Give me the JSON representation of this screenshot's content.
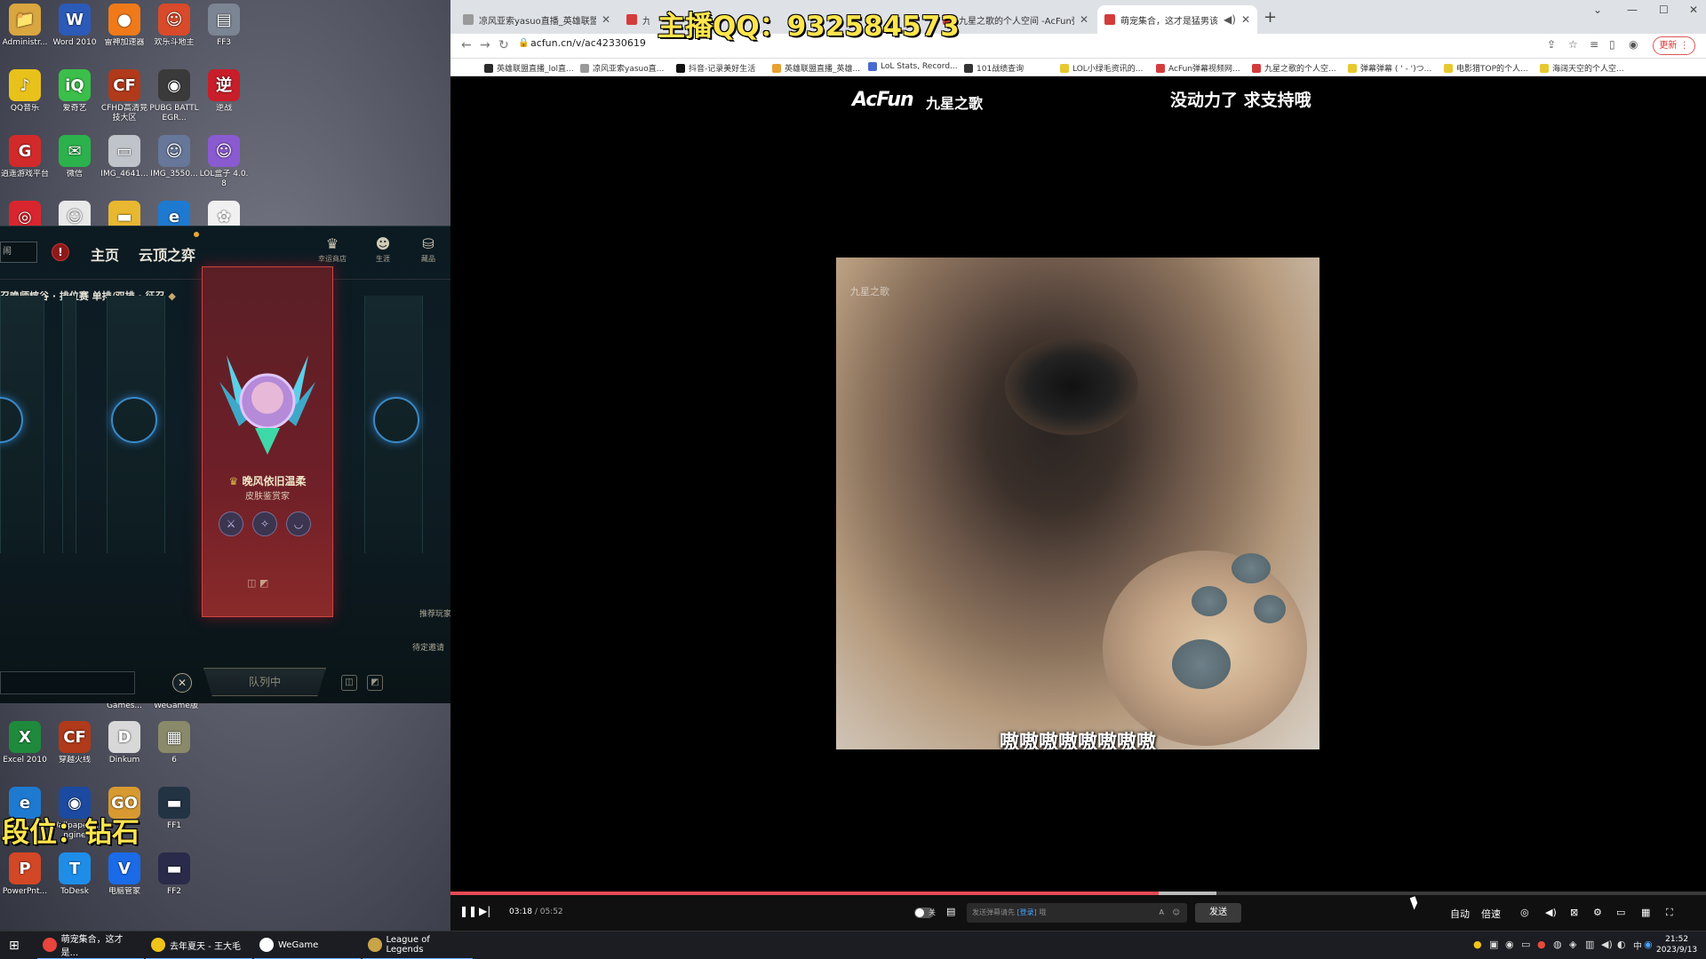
{
  "overlay": {
    "qq": "主播QQ：932584573",
    "rank": "段位：钻石"
  },
  "desktop": {
    "icons_top": [
      {
        "label": "Administr...",
        "glyph": "📁",
        "color": "#d9a640"
      },
      {
        "label": "Word 2010",
        "glyph": "W",
        "color": "#2b5ab8"
      },
      {
        "label": "雷神加速器",
        "glyph": "●",
        "color": "#f07a1a"
      },
      {
        "label": "欢乐斗地主",
        "glyph": "☺",
        "color": "#d94a2a"
      },
      {
        "label": "FF3",
        "glyph": "▤",
        "color": "#7b8593"
      },
      {
        "label": "QQ音乐",
        "glyph": "♪",
        "color": "#e8c21a"
      },
      {
        "label": "爱奇艺",
        "glyph": "iQ",
        "color": "#3bbf4a"
      },
      {
        "label": "CFHD高清竞技大区",
        "glyph": "CF",
        "color": "#b03a1a"
      },
      {
        "label": "PUBG BATTLEGR...",
        "glyph": "◉",
        "color": "#3a3a3a"
      },
      {
        "label": "逆战",
        "glyph": "逆",
        "color": "#c81e2a"
      },
      {
        "label": "逍遥游戏平台",
        "glyph": "G",
        "color": "#d22a2a"
      },
      {
        "label": "微信",
        "glyph": "✉",
        "color": "#2bb24c"
      },
      {
        "label": "IMG_4641...",
        "glyph": "▭",
        "color": "#bfc4ca"
      },
      {
        "label": "IMG_3550...",
        "glyph": "☺",
        "color": "#667799"
      },
      {
        "label": "LOL盒子 4.0.8",
        "glyph": "☺",
        "color": "#8a5ad0"
      },
      {
        "label": "",
        "glyph": "◎",
        "color": "#d9262e"
      },
      {
        "label": "",
        "glyph": "☺",
        "color": "#e8e8e8"
      },
      {
        "label": "",
        "glyph": "▬",
        "color": "#e8b830"
      },
      {
        "label": "",
        "glyph": "e",
        "color": "#1e7ad0"
      },
      {
        "label": "",
        "glyph": "✿",
        "color": "#f0f0f0"
      }
    ],
    "icons_bottom": [
      {
        "label": "Games...",
        "glyph": "",
        "color": "transparent"
      },
      {
        "label": "WeGame版",
        "glyph": "",
        "color": "transparent"
      },
      {
        "label": "Excel 2010",
        "glyph": "X",
        "color": "#1f8a3c"
      },
      {
        "label": "穿越火线",
        "glyph": "CF",
        "color": "#b03a1a"
      },
      {
        "label": "Dinkum",
        "glyph": "D",
        "color": "#d8d8d8"
      },
      {
        "label": "6",
        "glyph": "▦",
        "color": "#8a8a6a"
      },
      {
        "label": "",
        "glyph": "e",
        "color": "#1e7ad0"
      },
      {
        "label": "Wallpaper Engine",
        "glyph": "◉",
        "color": "#1b4aa0"
      },
      {
        "label": "",
        "glyph": "GO",
        "color": "#d89a30"
      },
      {
        "label": "FF1",
        "glyph": "▬",
        "color": "#223344"
      },
      {
        "label": "PowerPnt...",
        "glyph": "P",
        "color": "#d24726"
      },
      {
        "label": "ToDesk",
        "glyph": "T",
        "color": "#1e8de8"
      },
      {
        "label": "电脑管家",
        "glyph": "V",
        "color": "#1b6ae8"
      },
      {
        "label": "FF2",
        "glyph": "▬",
        "color": "#2a2a4a"
      }
    ]
  },
  "lol": {
    "search": "闹",
    "alert": "!",
    "nav_home": "主页",
    "nav_tft": "云顶之弈",
    "top_icons": [
      {
        "label": "幸运商店",
        "glyph": "♛"
      },
      {
        "label": "生涯",
        "glyph": "☻"
      },
      {
        "label": "藏品",
        "glyph": "⛁"
      }
    ],
    "mode_text": "召唤师峡谷 · 排位赛 单排/双排 · 征召",
    "player_name": "晚风依旧温柔",
    "player_title": "皮肤鉴赏家",
    "queue_button": "队列中",
    "side_hint_1": "推荐玩家",
    "side_hint_2": "待定邀请",
    "close": "✕"
  },
  "browser": {
    "tabs": [
      {
        "title": "凉风亚索yasuo直播_英雄联盟直",
        "color": "#9a9a9a"
      },
      {
        "title": "九星之歌",
        "color": "#d43c3c"
      },
      {
        "title": "九星之歌的个人空间 -AcFun弹幕",
        "color": "#d43c3c"
      },
      {
        "title": "萌宠集合，这才是猛男该求助...",
        "color": "#d43c3c"
      }
    ],
    "url": "acfun.cn/v/ac42330619",
    "update_label": "更新",
    "bookmarks": [
      "英雄联盟直播_lol直...",
      "凉风亚索yasuo直...",
      "抖音-记录美好生活",
      "英雄联盟直播_英雄...",
      "LoL Stats, Record...",
      "101战绩查询",
      "LOL小绿毛资讯的...",
      "AcFun弹幕视频网...",
      "九星之歌的个人空...",
      "弹幕弹幕 ( ' - ')つ...",
      "电影猎TOP的个人...",
      "海阔天空的个人空..."
    ]
  },
  "player": {
    "logo": "AcFun",
    "uploader": "九星之歌",
    "slogan": "没动力了 求支持哦",
    "watermark": "九星之歌",
    "subtitle": "嗷嗷嗷嗷嗷嗷嗷嗷",
    "time_current": "03:18",
    "time_total": "05:52",
    "progress": 0.564,
    "buffered": 0.61,
    "danmu_toggle": "关",
    "danmu_placeholder_pre": "发送弹幕请先",
    "danmu_placeholder_link": "[登录]",
    "danmu_placeholder_post": "哦",
    "send": "发送",
    "quality": "自动",
    "speed": "倍速"
  },
  "taskbar": {
    "items": [
      {
        "label": "萌宠集合，这才是...",
        "color": "#e8453c"
      },
      {
        "label": "去年夏天 - 王大毛",
        "color": "#f0c419"
      },
      {
        "label": "WeGame",
        "color": "#ffffff"
      },
      {
        "label": "League of Legends",
        "color": "#c9a448"
      }
    ],
    "time": "21:52",
    "date": "2023/9/13",
    "lang": "中"
  }
}
